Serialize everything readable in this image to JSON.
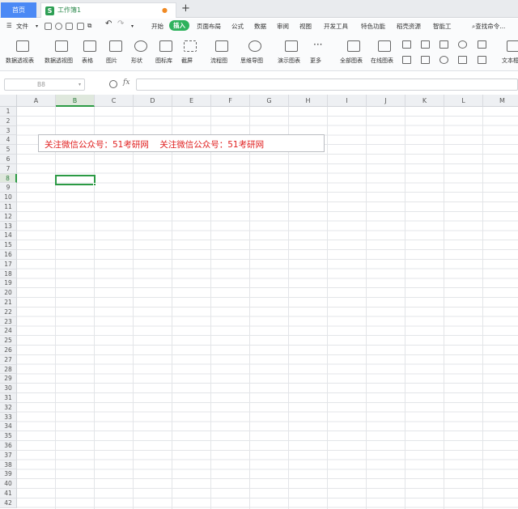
{
  "tabs": {
    "home": "首页",
    "doc": "工作簿1",
    "doc_icon": "S",
    "new": "+"
  },
  "menu": {
    "file": "文件",
    "items": [
      "开始",
      "插入",
      "页面布局",
      "公式",
      "数据",
      "审阅",
      "视图",
      "开发工具",
      "特色功能",
      "稻壳资源",
      "智能工"
    ],
    "selected_index": 1,
    "search": "查找命令..."
  },
  "ribbon": {
    "buttons": [
      "数据透视表",
      "数据透视图",
      "表格",
      "图片",
      "形状",
      "图标库",
      "截屏",
      "流程图",
      "思维导图",
      "演示图表",
      "更多",
      "全部图表",
      "在线图表"
    ],
    "right_label": "文本框"
  },
  "formula": {
    "cell": "B8",
    "fx": "fx",
    "value": ""
  },
  "sheet": {
    "columns": [
      "A",
      "B",
      "C",
      "D",
      "E",
      "F",
      "G",
      "H",
      "I",
      "J",
      "K",
      "L",
      "M"
    ],
    "selected_col": "B",
    "rows": [
      "1",
      "2",
      "3",
      "4",
      "5",
      "6",
      "7",
      "8",
      "9",
      "10",
      "11",
      "12",
      "13",
      "14",
      "15",
      "16",
      "17",
      "18",
      "19",
      "20",
      "21",
      "22",
      "23",
      "24",
      "25",
      "26",
      "27",
      "28",
      "29",
      "30",
      "31",
      "32",
      "33",
      "34",
      "35",
      "36",
      "37",
      "38",
      "39",
      "40",
      "41",
      "42"
    ],
    "selected_row": "8"
  },
  "textbox": {
    "text": "关注微信公众号：51考研网    关注微信公众号：51考研网"
  },
  "colors": {
    "accent": "#2fb25d",
    "home_tab": "#4b89f5",
    "text_red": "#e02020"
  }
}
